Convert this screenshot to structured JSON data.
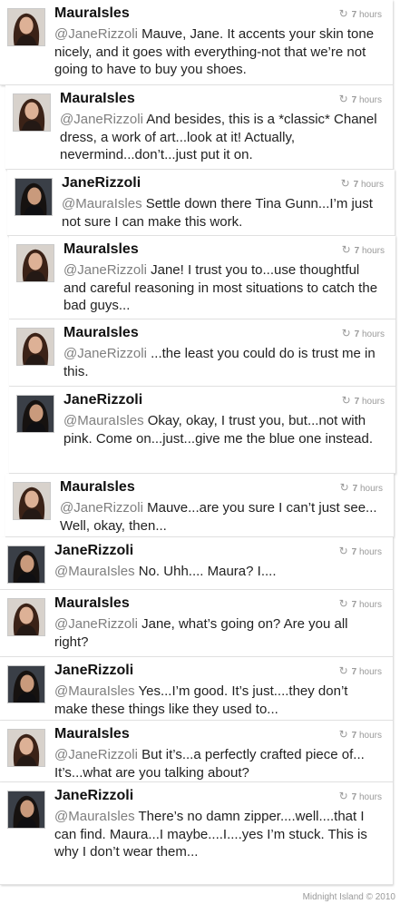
{
  "tweets": [
    {
      "user": "MauraIsles",
      "mention": "@JaneRizzoli",
      "text": " Mauve, Jane. It accents your skin tone nicely, and it goes with everything-not that we’re not going to have to buy you shoes.",
      "time_num": "7",
      "time_unit": "hours",
      "avatar": "maura-avatar"
    },
    {
      "user": "MauraIsles",
      "mention": "@JaneRizzoli",
      "text": " And besides, this is a *classic* Chanel dress, a work of art...look at it! Actually, nevermind...don’t...just put it on.",
      "time_num": "7",
      "time_unit": "hours",
      "avatar": "maura-avatar"
    },
    {
      "user": "JaneRizzoli",
      "mention": "@MauraIsles",
      "text": " Settle down there Tina Gunn...I’m just not sure I can make this work.",
      "time_num": "7",
      "time_unit": "hours",
      "avatar": "jane-avatar"
    },
    {
      "user": "MauraIsles",
      "mention": "@JaneRizzoli",
      "text": " Jane!  I trust you to...use thoughtful and careful reasoning in most situations to catch the bad guys...",
      "time_num": "7",
      "time_unit": "hours",
      "avatar": "maura-avatar"
    },
    {
      "user": "MauraIsles",
      "mention": "@JaneRizzoli",
      "text": " ...the least you could do is trust me in this.",
      "time_num": "7",
      "time_unit": "hours",
      "avatar": "maura-avatar"
    },
    {
      "user": "JaneRizzoli",
      "mention": "@MauraIsles",
      "text": " Okay, okay, I trust you, but...not with pink.  Come on...just...give me the blue one instead.",
      "time_num": "7",
      "time_unit": "hours",
      "avatar": "jane-avatar"
    },
    {
      "user": "MauraIsles",
      "mention": "@JaneRizzoli",
      "text": " Mauve...are you sure I can’t just see... Well, okay, then...",
      "time_num": "7",
      "time_unit": "hours",
      "avatar": "maura-avatar"
    },
    {
      "user": "JaneRizzoli",
      "mention": "@MauraIsles",
      "text": " No.  Uhh.... Maura? I....",
      "time_num": "7",
      "time_unit": "hours",
      "avatar": "jane-avatar"
    },
    {
      "user": "MauraIsles",
      "mention": "@JaneRizzoli",
      "text": " Jane, what’s going on?  Are you all right?",
      "time_num": "7",
      "time_unit": "hours",
      "avatar": "maura-avatar"
    },
    {
      "user": "JaneRizzoli",
      "mention": "@MauraIsles",
      "text": " Yes...I’m good.  It’s just....they don’t make these things like they used to...",
      "time_num": "7",
      "time_unit": "hours",
      "avatar": "jane-avatar"
    },
    {
      "user": "MauraIsles",
      "mention": "@JaneRizzoli",
      "text": " But it’s...a perfectly crafted piece of... It’s...what are you talking about?",
      "time_num": "7",
      "time_unit": "hours",
      "avatar": "maura-avatar"
    },
    {
      "user": "JaneRizzoli",
      "mention": "@MauraIsles",
      "text": " There’s no damn zipper....well....that I can find.  Maura...I maybe....I....yes I’m stuck.  This is why I don’t wear them...",
      "time_num": "7",
      "time_unit": "hours",
      "avatar": "jane-avatar"
    }
  ],
  "footer": "Midnight Island © 2010",
  "colors": {
    "mention": "#7f7f7f",
    "time": "#9a9a9a",
    "text": "#222222"
  }
}
